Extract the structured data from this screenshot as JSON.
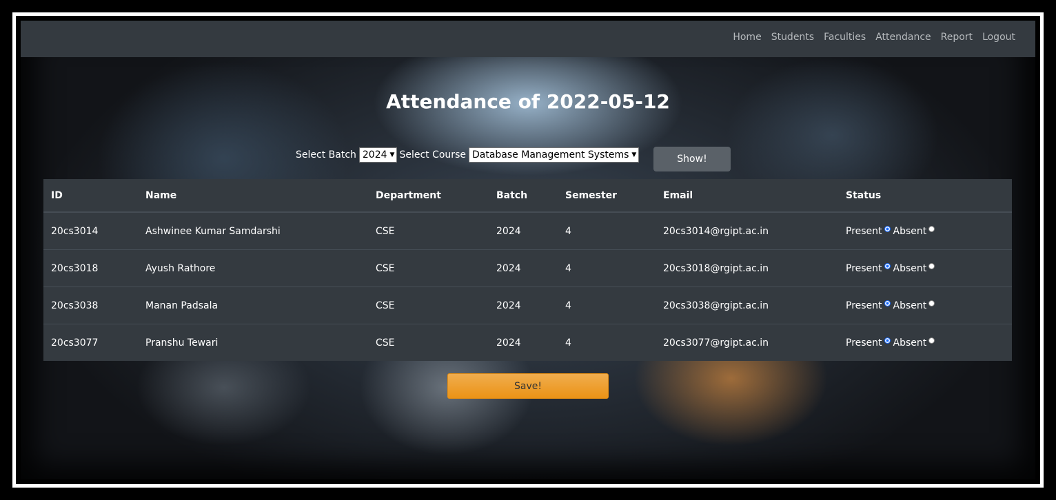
{
  "nav": {
    "items": [
      "Home",
      "Students",
      "Faculties",
      "Attendance",
      "Report",
      "Logout"
    ]
  },
  "page": {
    "title": "Attendance of 2022-05-12"
  },
  "filters": {
    "batch_label": "Select Batch",
    "batch_value": "2024",
    "course_label": "Select Course",
    "course_value": "Database Management Systems",
    "show_label": "Show!"
  },
  "table": {
    "headers": [
      "ID",
      "Name",
      "Department",
      "Batch",
      "Semester",
      "Email",
      "Status"
    ],
    "rows": [
      {
        "id": "20cs3014",
        "name": "Ashwinee Kumar Samdarshi",
        "department": "CSE",
        "batch": "2024",
        "semester": "4",
        "email": "20cs3014@rgipt.ac.in",
        "present_label": "Present",
        "absent_label": "Absent",
        "status": "present"
      },
      {
        "id": "20cs3018",
        "name": "Ayush Rathore",
        "department": "CSE",
        "batch": "2024",
        "semester": "4",
        "email": "20cs3018@rgipt.ac.in",
        "present_label": "Present",
        "absent_label": "Absent",
        "status": "present"
      },
      {
        "id": "20cs3038",
        "name": "Manan Padsala",
        "department": "CSE",
        "batch": "2024",
        "semester": "4",
        "email": "20cs3038@rgipt.ac.in",
        "present_label": "Present",
        "absent_label": "Absent",
        "status": "present"
      },
      {
        "id": "20cs3077",
        "name": "Pranshu Tewari",
        "department": "CSE",
        "batch": "2024",
        "semester": "4",
        "email": "20cs3077@rgipt.ac.in",
        "present_label": "Present",
        "absent_label": "Absent",
        "status": "present"
      }
    ]
  },
  "actions": {
    "save_label": "Save!"
  },
  "colors": {
    "navbar": "#343a40",
    "table_bg": "#343a40",
    "save_button": "#f0ad4e",
    "show_button": "#5a6168"
  }
}
